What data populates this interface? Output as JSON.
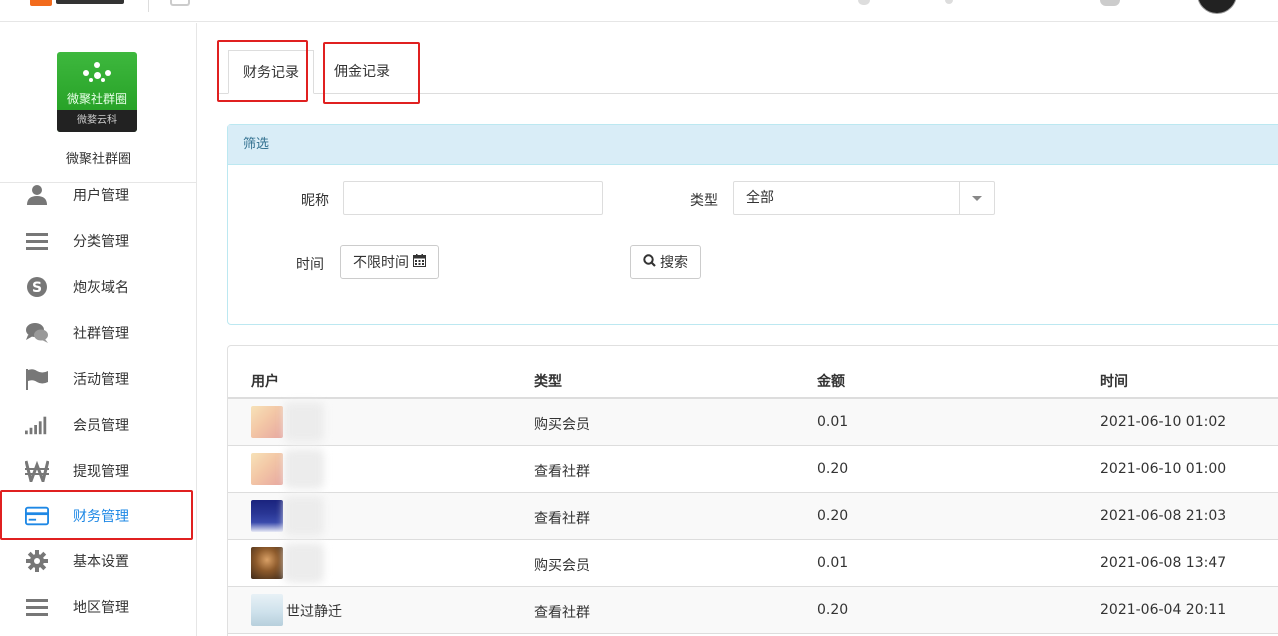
{
  "sidebar": {
    "brand": {
      "logo_name": "微聚社群圈",
      "logo_footer": "微婺云科",
      "title": "微聚社群圈"
    },
    "items": [
      {
        "label": "用户管理",
        "icon": "user-icon"
      },
      {
        "label": "分类管理",
        "icon": "bars-icon"
      },
      {
        "label": "炮灰域名",
        "icon": "skype-icon"
      },
      {
        "label": "社群管理",
        "icon": "comments-icon"
      },
      {
        "label": "活动管理",
        "icon": "flag-icon"
      },
      {
        "label": "会员管理",
        "icon": "signal-icon"
      },
      {
        "label": "提现管理",
        "icon": "won-icon"
      },
      {
        "label": "财务管理",
        "icon": "credit-card-icon",
        "active": true
      },
      {
        "label": "基本设置",
        "icon": "gear-icon"
      },
      {
        "label": "地区管理",
        "icon": "bars-icon"
      }
    ]
  },
  "tabs": [
    {
      "label": "财务记录",
      "active": true
    },
    {
      "label": "佣金记录",
      "active": false
    }
  ],
  "filter": {
    "title": "筛选",
    "nickname_label": "昵称",
    "nickname_value": "",
    "type_label": "类型",
    "type_value": "全部",
    "time_label": "时间",
    "time_value": "不限时间",
    "search_label": "搜索"
  },
  "table": {
    "headers": [
      "用户",
      "类型",
      "金额",
      "时间"
    ],
    "rows": [
      {
        "user": "",
        "type": "购买会员",
        "amount": "0.01",
        "time": "2021-06-10 01:02",
        "avatar": "cartoon"
      },
      {
        "user": "",
        "type": "查看社群",
        "amount": "0.20",
        "time": "2021-06-10 01:00",
        "avatar": "cartoon"
      },
      {
        "user": "",
        "type": "查看社群",
        "amount": "0.20",
        "time": "2021-06-08 21:03",
        "avatar": "poster"
      },
      {
        "user": "",
        "type": "购买会员",
        "amount": "0.01",
        "time": "2021-06-08 13:47",
        "avatar": "portrait"
      },
      {
        "user": "世过静迁",
        "type": "查看社群",
        "amount": "0.20",
        "time": "2021-06-04 20:11",
        "avatar": "landscape"
      }
    ]
  },
  "colors": {
    "accent": "#1e88e5",
    "annotation_red": "#e02020",
    "panel_header_bg": "#d9edf7",
    "panel_header_text": "#31708f"
  }
}
